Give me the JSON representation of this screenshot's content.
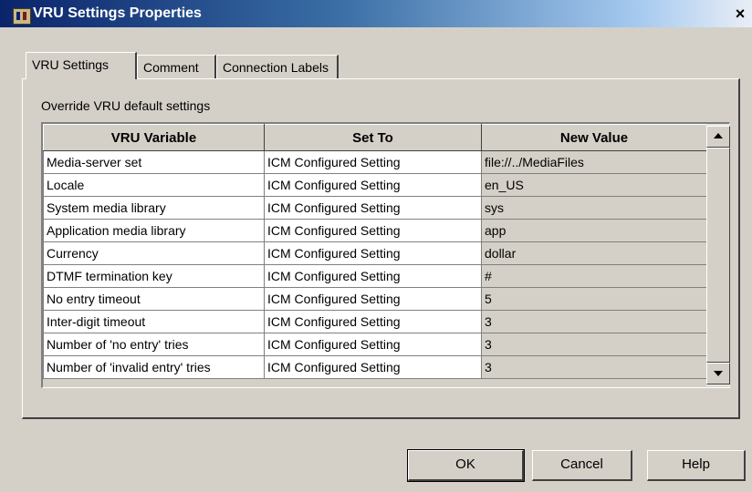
{
  "window": {
    "title": "VRU Settings Properties",
    "close_glyph": "×"
  },
  "tabs": [
    {
      "label": "VRU Settings",
      "active": true
    },
    {
      "label": "Comment",
      "active": false
    },
    {
      "label": "Connection Labels",
      "active": false
    }
  ],
  "section": {
    "label": "Override VRU default settings"
  },
  "grid": {
    "headers": [
      "VRU Variable",
      "Set To",
      "New Value"
    ],
    "rows": [
      {
        "variable": "Media-server set",
        "set_to": "ICM Configured Setting",
        "value": "file://../MediaFiles"
      },
      {
        "variable": "Locale",
        "set_to": "ICM Configured Setting",
        "value": "en_US"
      },
      {
        "variable": "System media library",
        "set_to": "ICM Configured Setting",
        "value": "sys"
      },
      {
        "variable": "Application media library",
        "set_to": "ICM Configured Setting",
        "value": "app"
      },
      {
        "variable": "Currency",
        "set_to": "ICM Configured Setting",
        "value": "dollar"
      },
      {
        "variable": "DTMF termination key",
        "set_to": "ICM Configured Setting",
        "value": "#"
      },
      {
        "variable": "No entry timeout",
        "set_to": "ICM Configured Setting",
        "value": "5"
      },
      {
        "variable": "Inter-digit timeout",
        "set_to": "ICM Configured Setting",
        "value": "3"
      },
      {
        "variable": "Number of 'no entry' tries",
        "set_to": "ICM Configured Setting",
        "value": "3"
      },
      {
        "variable": "Number of 'invalid entry' tries",
        "set_to": "ICM Configured Setting",
        "value": "3"
      }
    ]
  },
  "buttons": {
    "ok": "OK",
    "cancel": "Cancel",
    "help": "Help"
  },
  "icons": {
    "app": "vru-app-icon",
    "close": "close-icon",
    "scroll_up": "scroll-up-arrow-icon",
    "scroll_down": "scroll-down-arrow-icon"
  },
  "colors": {
    "titlebar_start": "#0a246a",
    "titlebar_end": "#a6caf0",
    "window_face": "#d4d0c8"
  }
}
